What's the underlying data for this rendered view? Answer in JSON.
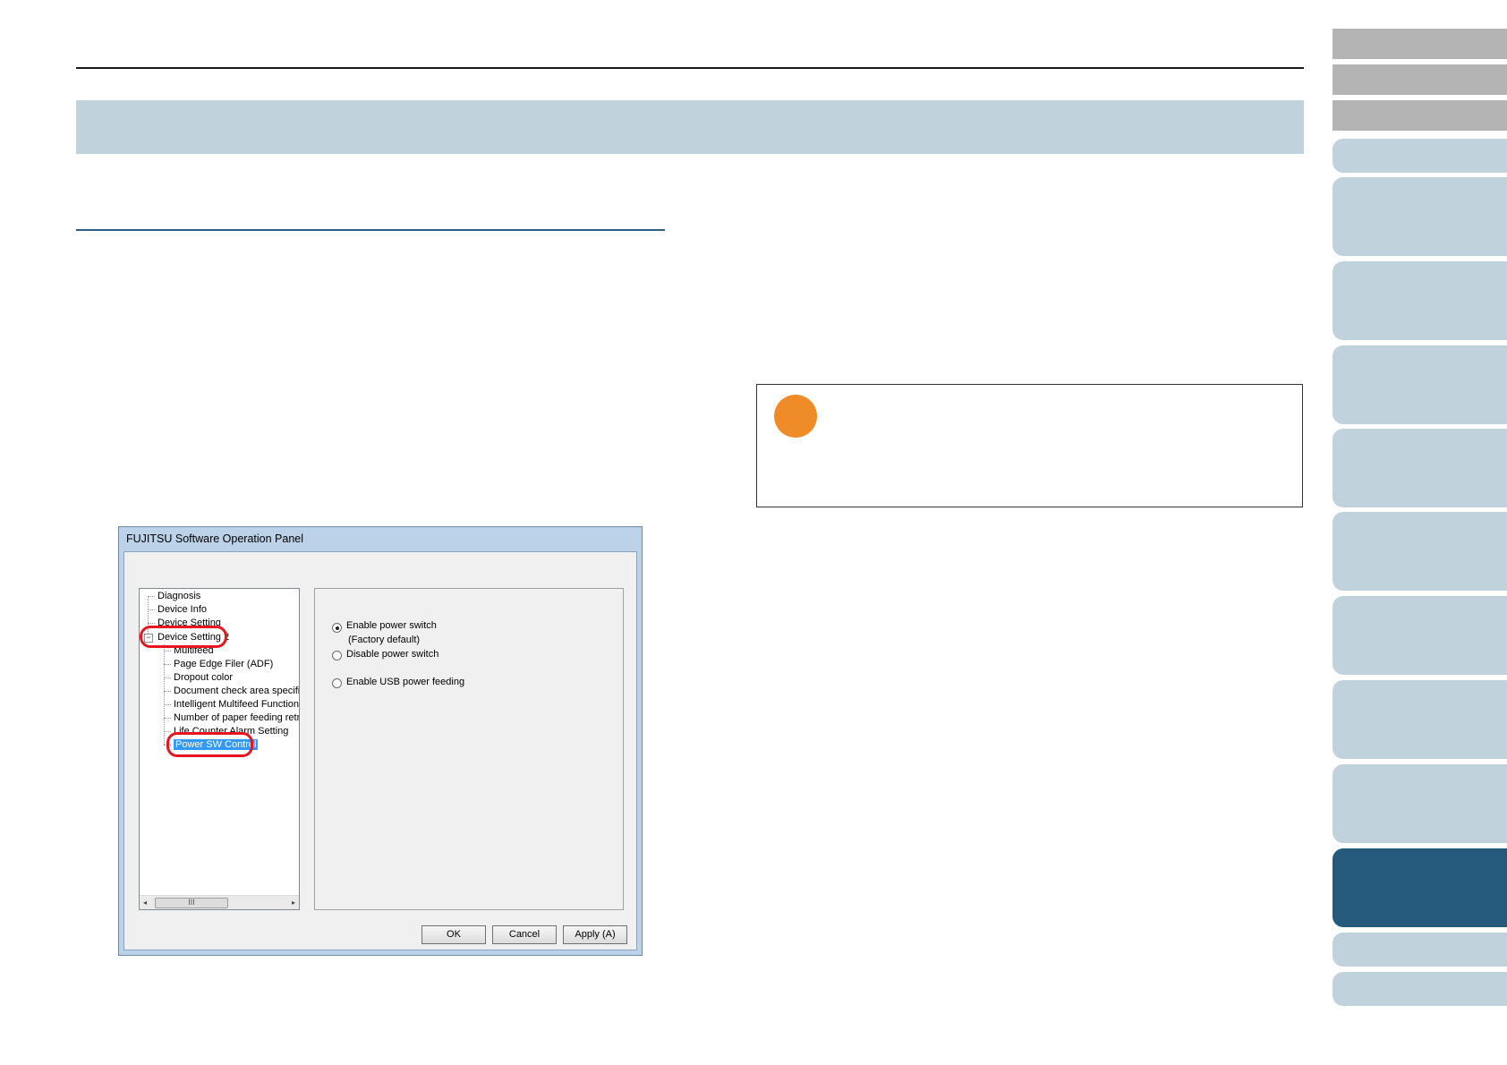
{
  "dialog": {
    "title": "FUJITSU Software Operation Panel",
    "tree": {
      "items": [
        {
          "label": "Diagnosis"
        },
        {
          "label": "Device Info"
        },
        {
          "label": "Device Setting"
        },
        {
          "label": "Device Setting 2"
        },
        {
          "label": "Multifeed"
        },
        {
          "label": "Page Edge Filer (ADF)"
        },
        {
          "label": "Dropout color"
        },
        {
          "label": "Document check area specific"
        },
        {
          "label": "Intelligent Multifeed Function"
        },
        {
          "label": "Number of paper feeding retrie"
        },
        {
          "label": "Life Counter Alarm Setting"
        },
        {
          "label": "Power SW Control"
        }
      ],
      "expander": "−",
      "scroll_thumb": "III",
      "scroll_left": "◂",
      "scroll_right": "▸"
    },
    "options": {
      "enable_power_switch": "Enable power switch",
      "factory_default": "(Factory default)",
      "disable_power_switch": "Disable power switch",
      "enable_usb_power": "Enable USB power feeding"
    },
    "buttons": {
      "ok": "OK",
      "cancel": "Cancel",
      "apply": "Apply (A)"
    }
  },
  "colors": {
    "band": "#c0d2dc",
    "active_tab": "#265a7d",
    "attention_icon": "#f08c28",
    "highlight_oval": "#e8141e"
  }
}
